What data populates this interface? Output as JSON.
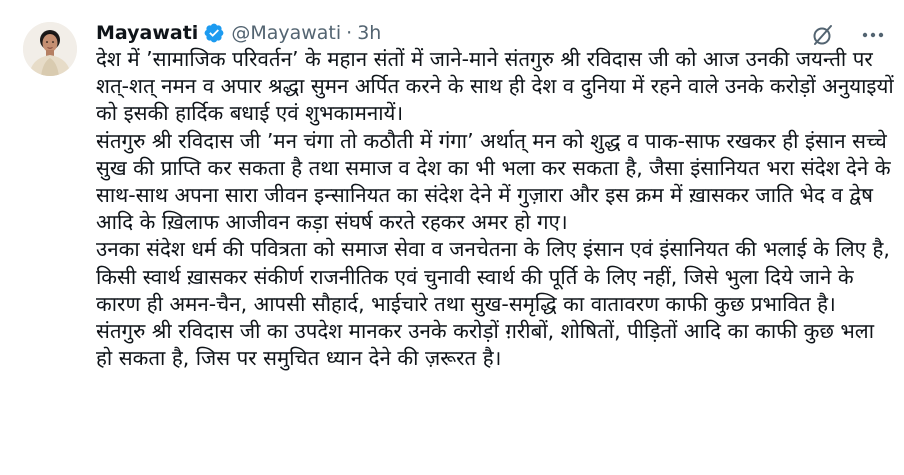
{
  "tweet": {
    "author": {
      "display_name": "Mayawati",
      "handle": "@Mayawati",
      "verified": true,
      "avatar": "profile-photo"
    },
    "separator": "·",
    "time": "3h",
    "actions": {
      "grok_icon": "slashed-circle-icon",
      "more_icon": "more-horizontal-icon"
    },
    "paragraphs": [
      "देश में ’सामाजिक परिवर्तन’ के महान संतों में जाने-माने संतगुरु श्री रविदास जी को आज उनकी जयन्ती पर शत्-शत् नमन व अपार श्रद्धा सुमन अर्पित करने के साथ ही देश व दुनिया में रहने वाले उनके करोड़ों अनुयाइयों को इसकी हार्दिक बधाई एवं शुभकामनायें।",
      "संतगुरु श्री रविदास जी ’मन चंगा तो कठौती में गंगा’ अर्थात् मन को शुद्ध व पाक-साफ रखकर ही इंसान सच्चे सुख की प्राप्ति कर सकता है तथा समाज व देश का भी भला कर सकता है, जैसा इंसानियत भरा संदेश देने के साथ-साथ अपना सारा जीवन इन्सानियत का संदेश देने में गुज़ारा और इस क्रम में ख़ासकर जाति भेद व द्वेष आदि के ख़िलाफ आजीवन कड़ा संघर्ष करते रहकर अमर हो गए।",
      "उनका संदेश धर्म की पवित्रता को समाज सेवा व जनचेतना के लिए इंसान एवं इंसानियत की भलाई के लिए है, किसी स्वार्थ ख़ासकर संकीर्ण राजनीतिक एवं चुनावी स्वार्थ की पूर्ति के लिए नहीं, जिसे भुला दिये जाने के कारण ही अमन-चैन, आपसी सौहार्द, भाईचारे तथा सुख-समृद्धि का वातावरण काफी कुछ प्रभावित है।",
      "संतगुरु श्री रविदास जी का उपदेश मानकर उनके करोड़ों ग़रीबों, शोषितों, पीड़ितों आदि का काफी कुछ भला हो सकता है, जिस पर समुचित ध्यान देने की ज़रूरत है।"
    ],
    "colors": {
      "text": "#0f1419",
      "secondary": "#536471",
      "verified": "#1d9bf0"
    }
  }
}
